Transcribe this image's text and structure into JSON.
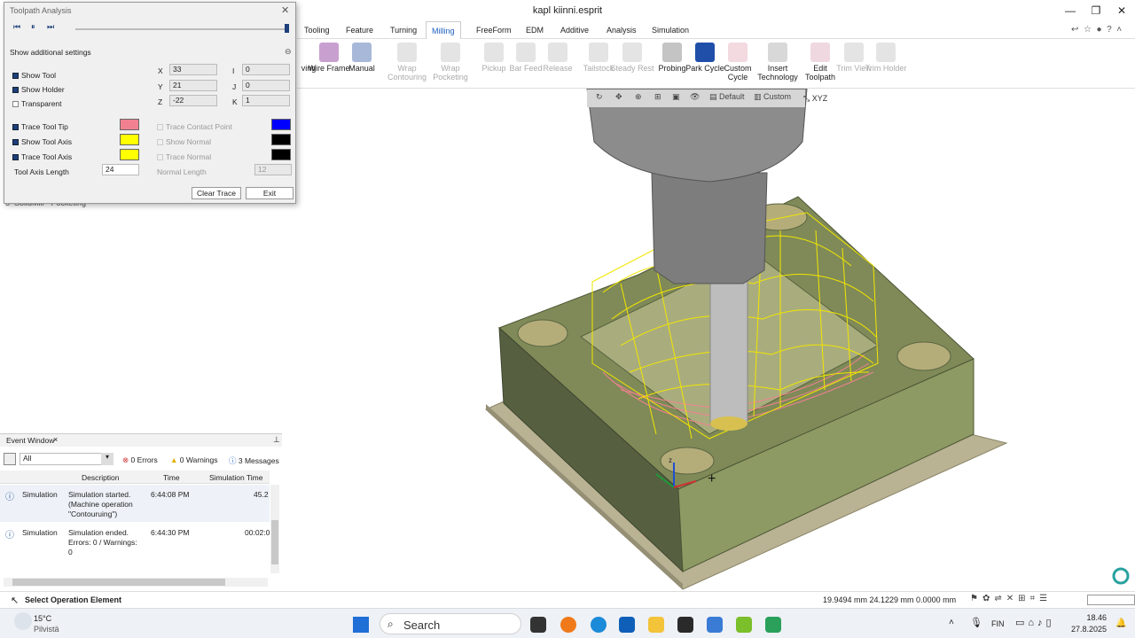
{
  "window": {
    "title": "kapl kiinni.esprit",
    "minimize": "—",
    "restore": "❐",
    "close": "✕"
  },
  "tabs": [
    {
      "label": "Tooling"
    },
    {
      "label": "Feature"
    },
    {
      "label": "Turning"
    },
    {
      "label": "Milling"
    },
    {
      "label": "FreeForm"
    },
    {
      "label": "EDM"
    },
    {
      "label": "Additive"
    },
    {
      "label": "Analysis"
    },
    {
      "label": "Simulation"
    }
  ],
  "ribbon": [
    {
      "label": "ving",
      "disabled": false
    },
    {
      "label": "Wire Frame",
      "disabled": false
    },
    {
      "label": "Manual",
      "disabled": false
    },
    {
      "label": "Wrap Contouring",
      "disabled": true
    },
    {
      "label": "Wrap Pocketing",
      "disabled": true
    },
    {
      "label": "Pickup",
      "disabled": true
    },
    {
      "label": "Bar Feed",
      "disabled": true
    },
    {
      "label": "Release",
      "disabled": true
    },
    {
      "label": "Tailstock",
      "disabled": true
    },
    {
      "label": "Steady Rest",
      "disabled": true
    },
    {
      "label": "Probing",
      "disabled": false
    },
    {
      "label": "Park Cycle",
      "disabled": false
    },
    {
      "label": "Custom Cycle",
      "disabled": false
    },
    {
      "label": "Insert Technology",
      "disabled": false
    },
    {
      "label": "Edit Toolpath",
      "disabled": false
    },
    {
      "label": "Trim View",
      "disabled": true
    },
    {
      "label": "Trim Holder",
      "disabled": true
    }
  ],
  "viewtoolbar": {
    "default": "Default",
    "custom": "Custom",
    "xyz": "XYZ"
  },
  "dialog": {
    "title": "Toolpath Analysis",
    "additional": "Show additional settings",
    "show_tool": "Show Tool",
    "show_holder": "Show Holder",
    "transparent": "Transparent",
    "x_label": "X",
    "y_label": "Y",
    "z_label": "Z",
    "i_label": "I",
    "j_label": "J",
    "k_label": "K",
    "x": "33",
    "y": "21",
    "z": "-22",
    "i": "0",
    "j": "0",
    "k": "1",
    "trace_tool_tip": "Trace Tool Tip",
    "show_tool_axis": "Show Tool Axis",
    "trace_tool_axis": "Trace Tool Axis",
    "trace_contact_point": "Trace Contact Point",
    "show_normal": "Show Normal",
    "trace_normal": "Trace Normal",
    "tool_axis_length_label": "Tool Axis Length",
    "tool_axis_length": "24",
    "normal_length_label": "Normal Length",
    "normal_length": "12",
    "clear_trace": "Clear Trace",
    "exit": "Exit",
    "colors": {
      "tip": "#f08090",
      "axis": "#ffff00",
      "trace_axis": "#ffff00",
      "contact": "#0000ff",
      "normal": "#000000",
      "trace_normal": "#000000"
    }
  },
  "tree_row": "SolidMill - Pocketing",
  "tree_row_num": "3",
  "event": {
    "title": "Event Window",
    "filter": "All",
    "errors": "0 Errors",
    "warnings": "0 Warnings",
    "messages": "3 Messages",
    "col_desc": "Description",
    "col_time": "Time",
    "col_sim": "Simulation Time",
    "rows": [
      {
        "type": "Simulation",
        "desc": "Simulation started. (Machine operation \"Contouruing\")",
        "time": "6:44:08 PM",
        "sim": "45.2"
      },
      {
        "type": "Simulation",
        "desc": "Simulation ended. Errors: 0 / Warnings: 0",
        "time": "6:44:30 PM",
        "sim": "00:02:0"
      }
    ]
  },
  "status": {
    "hint": "Select Operation Element",
    "coords": "19.9494 mm  24.1229 mm  0.0000 mm"
  },
  "taskbar": {
    "temp": "15°C",
    "weather": "Pilvistä",
    "search": "Search",
    "lang": "FIN",
    "time": "18.46",
    "date": "27.8.2025"
  }
}
